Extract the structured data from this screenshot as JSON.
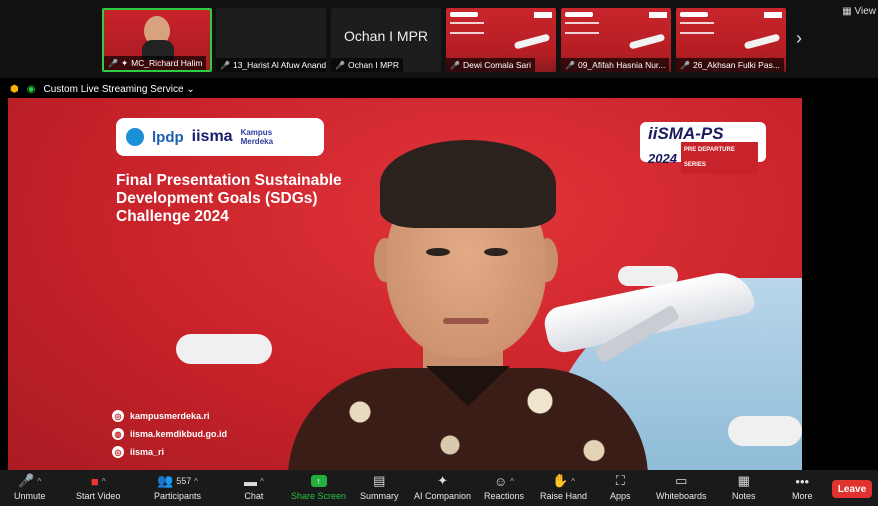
{
  "gallery": {
    "tiles": [
      {
        "name": "MC_Richard Halim",
        "active": true
      },
      {
        "name": "13_Harist Al Afuw Anandi_...",
        "active": false
      },
      {
        "name": "Ochan I MPR",
        "center_label": "Ochan I MPR",
        "active": false
      },
      {
        "name": "Dewi Comala Sari",
        "active": false
      },
      {
        "name": "09_Afifah Hasnia Nur...",
        "active": false
      },
      {
        "name": "26_Akhsan Fulki Pas...",
        "active": false
      }
    ],
    "next_icon": "chevron-right-icon",
    "view_label": "View"
  },
  "status": {
    "stream_label": "Custom Live Streaming Service"
  },
  "slide": {
    "logo_lpdp": "lpdp",
    "logo_iisma": "iisma",
    "logo_km_line1": "Kampus",
    "logo_km_line2": "Merdeka",
    "ps_title": "iiSMA-PS",
    "ps_year": "2024",
    "ps_sub": "PRE DEPARTURE SERIES",
    "title": "Final Presentation Sustainable Development Goals (SDGs) Challenge 2024",
    "social": [
      {
        "icon": "instagram-icon",
        "text": "kampusmerdeka.ri"
      },
      {
        "icon": "globe-icon",
        "text": "iisma.kemdikbud.go.id"
      },
      {
        "icon": "instagram-icon",
        "text": "iisma_ri"
      }
    ]
  },
  "toolbar": {
    "unmute": "Unmute",
    "start_video": "Start Video",
    "participants": "Participants",
    "participants_count": "557",
    "chat": "Chat",
    "share_screen": "Share Screen",
    "summary": "Summary",
    "ai_companion": "AI Companion",
    "reactions": "Reactions",
    "raise_hand": "Raise Hand",
    "apps": "Apps",
    "whiteboards": "Whiteboards",
    "notes": "Notes",
    "more": "More",
    "leave": "Leave"
  },
  "colors": {
    "slide_red": "#c8222a",
    "share_green": "#23b040",
    "leave_red": "#e0322e",
    "active_border": "#2ecc40"
  }
}
